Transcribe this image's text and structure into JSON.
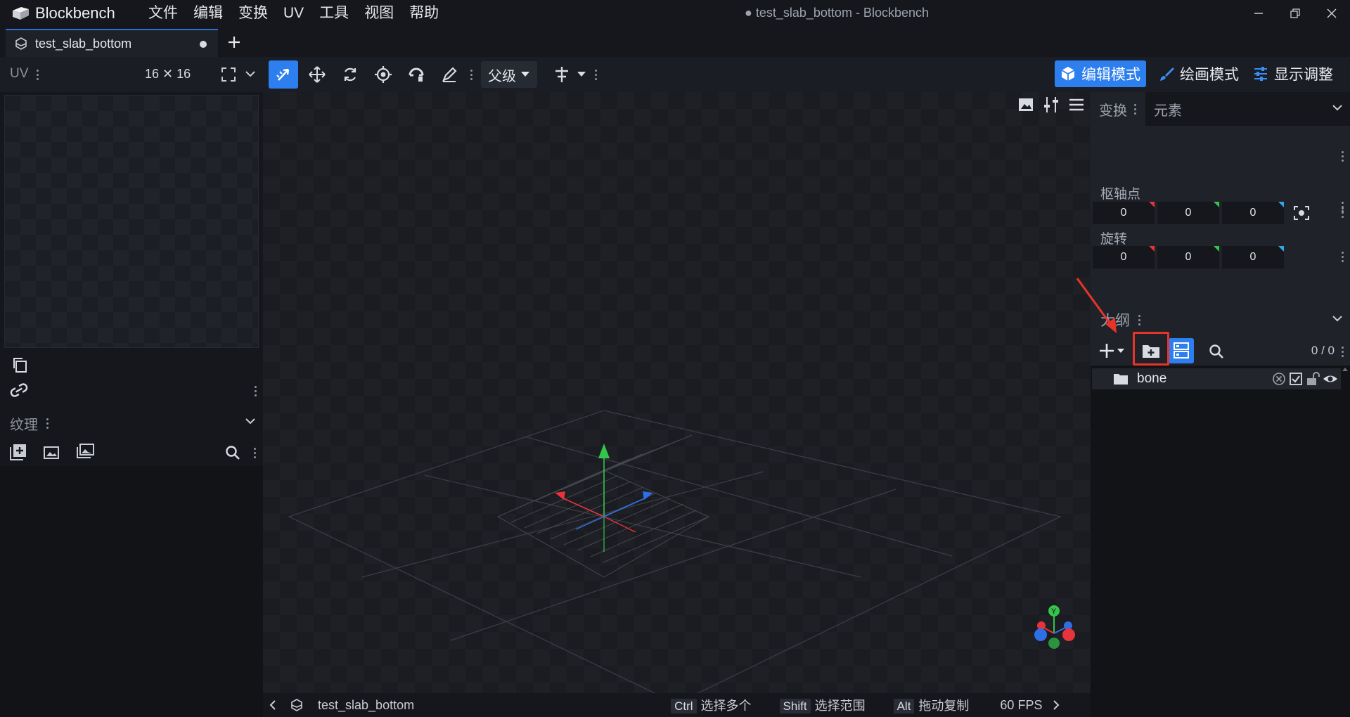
{
  "app": {
    "name": "Blockbench",
    "window_title": "● test_slab_bottom - Blockbench"
  },
  "menu": [
    "文件",
    "编辑",
    "变换",
    "UV",
    "工具",
    "视图",
    "帮助"
  ],
  "tabs": [
    {
      "label": "test_slab_bottom",
      "unsaved": true
    }
  ],
  "toolbar": {
    "uv_label": "UV",
    "uv_size": "16 ✕ 16",
    "parent_select": "父级",
    "modes": [
      {
        "label": "编辑模式",
        "active": true
      },
      {
        "label": "绘画模式",
        "active": false
      },
      {
        "label": "显示调整",
        "active": false
      }
    ]
  },
  "left_panel": {
    "textures_title": "纹理"
  },
  "right_panel": {
    "tabs": [
      "变换",
      "元素"
    ],
    "pivot_label": "枢轴点",
    "pivot_values": [
      "0",
      "0",
      "0"
    ],
    "rotation_label": "旋转",
    "rotation_values": [
      "0",
      "0",
      "0"
    ],
    "outliner_title": "大纲",
    "outliner_count": "0 / 0",
    "outliner_items": [
      {
        "label": "bone",
        "type": "group"
      }
    ]
  },
  "statusbar": {
    "project_name": "test_slab_bottom",
    "hints": [
      {
        "key": "Ctrl",
        "label": "选择多个"
      },
      {
        "key": "Shift",
        "label": "选择范围"
      },
      {
        "key": "Alt",
        "label": "拖动复制"
      }
    ],
    "fps": "60 FPS"
  },
  "colors": {
    "accent": "#2d7ff0",
    "axis_x": "#e8333b",
    "axis_y": "#33c44a",
    "axis_z": "#2f6fe6",
    "annotation": "#e8332b"
  }
}
